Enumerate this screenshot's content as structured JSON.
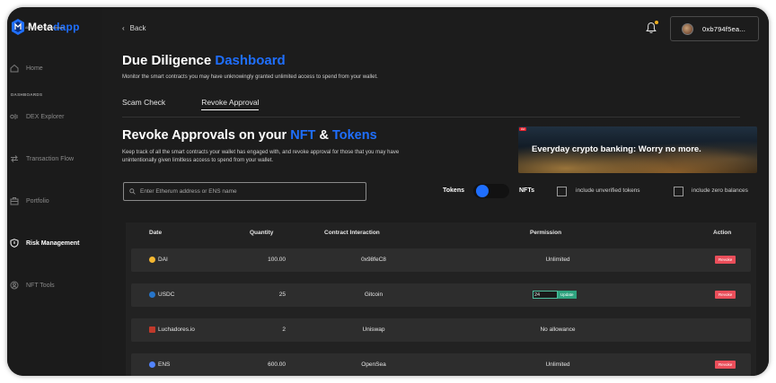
{
  "brand": {
    "name_a": "Meta",
    "name_b": "dapp",
    "tagline": "All-in-one Web3 Dashboard",
    "accent": "#1f6fff"
  },
  "sidebar": {
    "section_label": "DASHBOARDS",
    "items": [
      {
        "label": "Home",
        "icon": "home-icon"
      },
      {
        "label": "DEX Explorer",
        "icon": "dex-icon"
      },
      {
        "label": "Transaction Flow",
        "icon": "transfer-icon"
      },
      {
        "label": "Portfolio",
        "icon": "briefcase-icon"
      },
      {
        "label": "Risk Management",
        "icon": "shield-icon",
        "active": true
      },
      {
        "label": "NFT Tools",
        "icon": "nft-icon"
      }
    ]
  },
  "header": {
    "back_label": "Back",
    "wallet_address": "0xb794f5ea..."
  },
  "page": {
    "title_a": "Due Diligence",
    "title_b": "Dashboard",
    "subtitle": "Monitor the smart contracts you may have unknowingly granted  unlimited access to spend from your wallet.",
    "tabs": [
      {
        "label": "Scam Check"
      },
      {
        "label": "Revoke Approval",
        "active": true
      }
    ]
  },
  "section": {
    "title_a": "Revoke Approvals on your",
    "title_nft": "NFT",
    "title_amp": "&",
    "title_tokens": "Tokens",
    "description": "Keep track of all the smart contracts your wallet has engaged with, and revoke approval for those that you may have unintentionally given limitless access to spend from your wallet."
  },
  "banner": {
    "badge": "Ad",
    "text": "Everyday crypto banking: Worry no more."
  },
  "controls": {
    "search_placeholder": "Enter Etherum address or ENS name",
    "toggle_left": "Tokens",
    "toggle_right": "NFTs",
    "toggle_state": "Tokens",
    "check_unverified": "include unverified tokens",
    "check_zero": "include zero balances"
  },
  "table": {
    "headers": {
      "date": "Date",
      "quantity": "Quantity",
      "contract": "Contract Interaction",
      "permission": "Permission",
      "action": "Action"
    },
    "rows": [
      {
        "token": "DAI",
        "icon_color": "#f4b731",
        "quantity": "100.00",
        "contract": "0x98feC8",
        "permission": "Unlimited",
        "action": "Revoke"
      },
      {
        "token": "USDC",
        "icon_color": "#2775ca",
        "quantity": "25",
        "contract": "Gitcoin",
        "permission_value": "24",
        "permission_button": "Update",
        "action": "Revoke"
      },
      {
        "token": "Luchadores.io",
        "icon_color": "#c0392b",
        "quantity": "2",
        "contract": "Uniswap",
        "permission": "No allowance",
        "action": ""
      },
      {
        "token": "ENS",
        "icon_color": "#5284ff",
        "quantity": "600.00",
        "contract": "OpenSea",
        "permission": "Unlimited",
        "action": "Revoke"
      }
    ]
  }
}
